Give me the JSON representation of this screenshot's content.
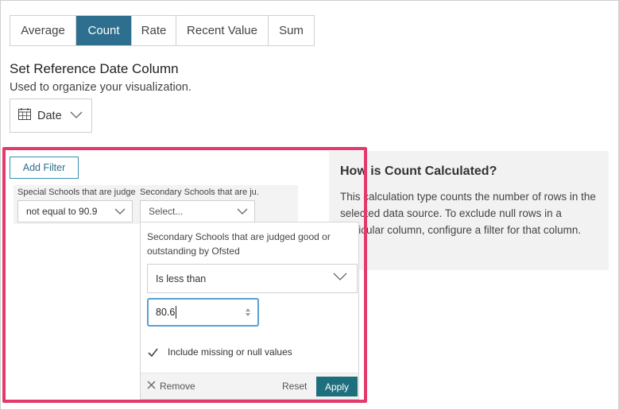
{
  "tabs": [
    {
      "label": "Average",
      "active": false
    },
    {
      "label": "Count",
      "active": true
    },
    {
      "label": "Rate",
      "active": false
    },
    {
      "label": "Recent Value",
      "active": false
    },
    {
      "label": "Sum",
      "active": false
    }
  ],
  "reference": {
    "title": "Set Reference Date Column",
    "subtitle": "Used to organize your visualization.",
    "date_label": "Date",
    "icon": "calendar-icon"
  },
  "filters": {
    "add_label": "Add Filter",
    "filter1": {
      "label": "Special Schools that are judge...",
      "value": "not equal to 90.9"
    },
    "filter2": {
      "label": "Secondary Schools that are ju...",
      "placeholder": "Select..."
    }
  },
  "popup": {
    "title": "Secondary Schools that are judged good or outstanding by Ofsted",
    "operator": "Is less than",
    "value": "80.6",
    "include_label": "Include missing or null values",
    "include_checked": true,
    "remove_label": "Remove",
    "reset_label": "Reset",
    "apply_label": "Apply"
  },
  "info": {
    "title": "How is Count Calculated?",
    "body": "This calculation type counts the number of rows in the selected data source. To exclude null rows in a particular column, configure a filter for that column."
  },
  "colors": {
    "accent": "#2e6e8e",
    "highlight": "#e23a6a",
    "apply": "#1e6f7d"
  }
}
